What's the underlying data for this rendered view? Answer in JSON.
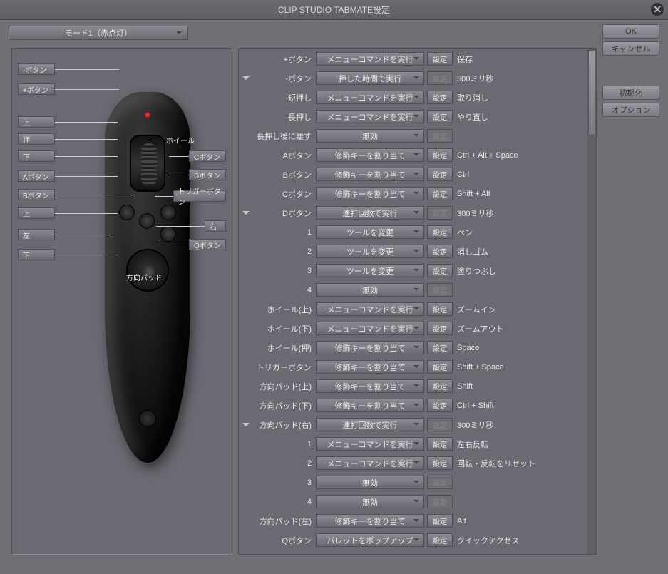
{
  "title": "CLIP STUDIO TABMATE設定",
  "mode_selector": "モード1（赤点灯）",
  "buttons": {
    "ok": "OK",
    "cancel": "キャンセル",
    "init": "初期化",
    "options": "オプション",
    "set": "設定"
  },
  "device_labels": {
    "minus": "-ボタン",
    "plus": "+ボタン",
    "up1": "上",
    "press": "押",
    "down1": "下",
    "a": "Aボタン",
    "b": "Bボタン",
    "up2": "上",
    "left": "左",
    "down2": "下",
    "wheel": "ホイール",
    "c": "Cボタン",
    "d": "Dボタン",
    "trigger": "トリガーボタン",
    "right": "右",
    "q": "Qボタン",
    "dpad": "方向パッド"
  },
  "rows": [
    {
      "id": "plus",
      "label": "+ボタン",
      "action": "メニューコマンドを実行",
      "set": true,
      "value": "保存"
    },
    {
      "id": "minus",
      "label": "-ボタン",
      "action": "押した時間で実行",
      "set": false,
      "value": "500ミリ秒",
      "expand": true
    },
    {
      "id": "short",
      "label": "短押し",
      "action": "メニューコマンドを実行",
      "set": true,
      "value": "取り消し",
      "sub": true
    },
    {
      "id": "long",
      "label": "長押し",
      "action": "メニューコマンドを実行",
      "set": true,
      "value": "やり直し",
      "sub": true
    },
    {
      "id": "release",
      "label": "長押し後に離す",
      "action": "無効",
      "set": false,
      "value": "",
      "sub": true
    },
    {
      "id": "a",
      "label": "Aボタン",
      "action": "修飾キーを割り当て",
      "set": true,
      "value": "Ctrl + Alt + Space"
    },
    {
      "id": "b",
      "label": "Bボタン",
      "action": "修飾キーを割り当て",
      "set": true,
      "value": "Ctrl"
    },
    {
      "id": "c",
      "label": "Cボタン",
      "action": "修飾キーを割り当て",
      "set": true,
      "value": "Shift + Alt"
    },
    {
      "id": "d",
      "label": "Dボタン",
      "action": "連打回数で実行",
      "set": false,
      "value": "300ミリ秒",
      "expand": true
    },
    {
      "id": "d1",
      "label": "1",
      "action": "ツールを変更",
      "set": true,
      "value": "ペン",
      "sub": true
    },
    {
      "id": "d2",
      "label": "2",
      "action": "ツールを変更",
      "set": true,
      "value": "消しゴム",
      "sub": true
    },
    {
      "id": "d3",
      "label": "3",
      "action": "ツールを変更",
      "set": true,
      "value": "塗りつぶし",
      "sub": true
    },
    {
      "id": "d4",
      "label": "4",
      "action": "無効",
      "set": false,
      "value": "",
      "sub": true
    },
    {
      "id": "wu",
      "label": "ホイール(上)",
      "action": "メニューコマンドを実行",
      "set": true,
      "value": "ズームイン"
    },
    {
      "id": "wd",
      "label": "ホイール(下)",
      "action": "メニューコマンドを実行",
      "set": true,
      "value": "ズームアウト"
    },
    {
      "id": "wp",
      "label": "ホイール(押)",
      "action": "修飾キーを割り当て",
      "set": true,
      "value": "Space"
    },
    {
      "id": "tr",
      "label": "トリガーボタン",
      "action": "修飾キーを割り当て",
      "set": true,
      "value": "Shift + Space"
    },
    {
      "id": "pu",
      "label": "方向パッド(上)",
      "action": "修飾キーを割り当て",
      "set": true,
      "value": "Shift"
    },
    {
      "id": "pd2",
      "label": "方向パッド(下)",
      "action": "修飾キーを割り当て",
      "set": true,
      "value": "Ctrl + Shift"
    },
    {
      "id": "pr",
      "label": "方向パッド(右)",
      "action": "連打回数で実行",
      "set": false,
      "value": "300ミリ秒",
      "expand": true
    },
    {
      "id": "pr1",
      "label": "1",
      "action": "メニューコマンドを実行",
      "set": true,
      "value": "左右反転",
      "sub": true
    },
    {
      "id": "pr2",
      "label": "2",
      "action": "メニューコマンドを実行",
      "set": true,
      "value": "回転・反転をリセット",
      "sub": true
    },
    {
      "id": "pr3",
      "label": "3",
      "action": "無効",
      "set": false,
      "value": "",
      "sub": true
    },
    {
      "id": "pr4",
      "label": "4",
      "action": "無効",
      "set": false,
      "value": "",
      "sub": true
    },
    {
      "id": "pl",
      "label": "方向パッド(左)",
      "action": "修飾キーを割り当て",
      "set": true,
      "value": "Alt"
    },
    {
      "id": "q",
      "label": "Qボタン",
      "action": "パレットをポップアップ",
      "set": true,
      "value": "クイックアクセス"
    }
  ]
}
